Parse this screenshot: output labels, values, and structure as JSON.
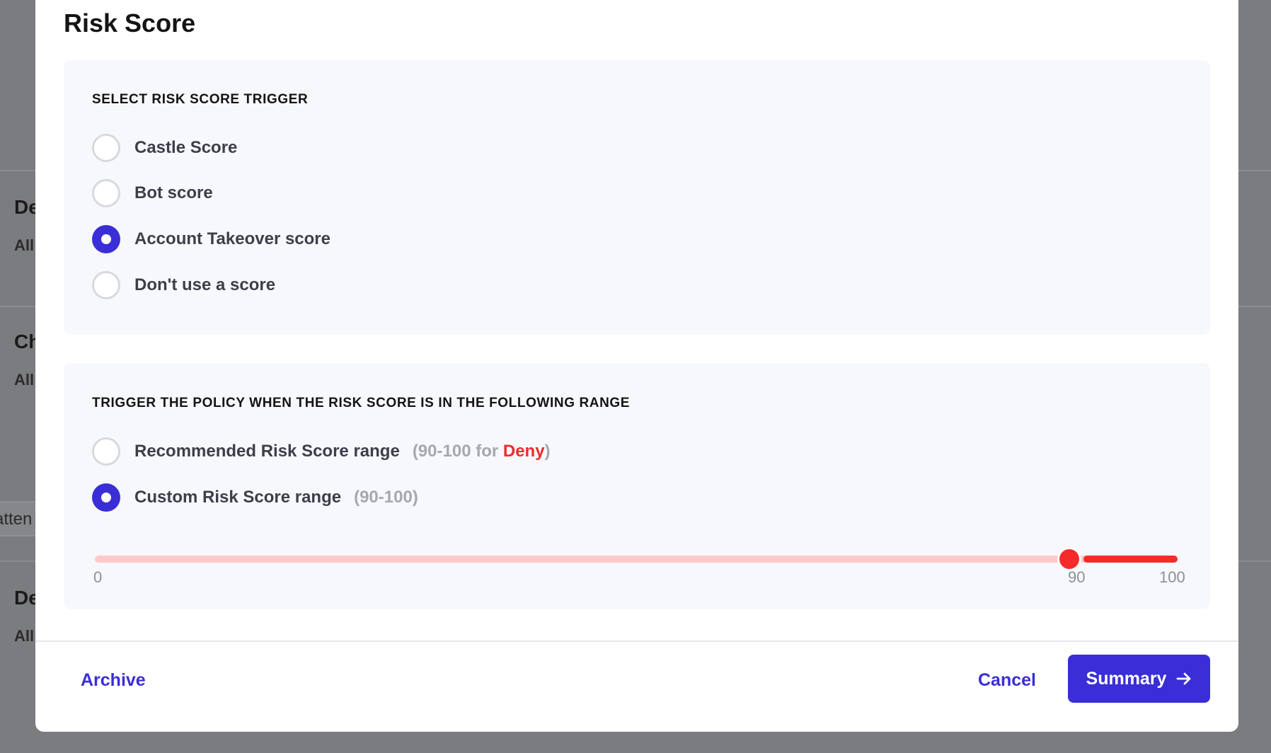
{
  "background": {
    "cards": [
      {
        "title": "De",
        "subtitle": "All"
      },
      {
        "title": "Ch",
        "subtitle": "All"
      },
      {
        "input_text": "atten"
      },
      {
        "title": "De",
        "subtitle": "All"
      }
    ]
  },
  "modal": {
    "title": "Risk Score",
    "trigger_section": {
      "heading": "SELECT RISK SCORE TRIGGER",
      "options": [
        {
          "label": "Castle Score",
          "selected": false
        },
        {
          "label": "Bot score",
          "selected": false
        },
        {
          "label": "Account Takeover score",
          "selected": true
        },
        {
          "label": "Don't use a score",
          "selected": false
        }
      ]
    },
    "range_section": {
      "heading": "TRIGGER THE POLICY WHEN THE RISK SCORE IS IN THE FOLLOWING RANGE",
      "recommended": {
        "label": "Recommended Risk Score range",
        "hint_open": "(90-100 for ",
        "hint_action": "Deny",
        "hint_close": ")",
        "selected": false
      },
      "custom": {
        "label": "Custom Risk Score range",
        "hint": "(90-100)",
        "selected": true
      },
      "slider": {
        "min": 0,
        "max": 100,
        "value": 90,
        "labels": {
          "min": "0",
          "value": "90",
          "max": "100"
        },
        "track_color": "#fcc9c9",
        "fill_color": "#f52b2b"
      }
    },
    "footer": {
      "archive_label": "Archive",
      "cancel_label": "Cancel",
      "primary_label": "Summary",
      "primary_icon": "arrow-right-icon"
    }
  },
  "colors": {
    "accent": "#3a2ed6",
    "danger": "#ee2b2b",
    "panel_bg": "#f7f8fc",
    "overlay": "#7b7c7f"
  }
}
